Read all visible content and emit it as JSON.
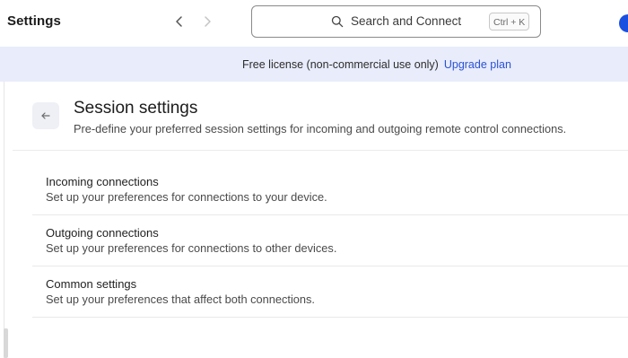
{
  "app": {
    "title": "Settings"
  },
  "search": {
    "text": "Search and Connect",
    "shortcut": "Ctrl + K"
  },
  "license": {
    "text": "Free license (non-commercial use only)",
    "upgrade_label": "Upgrade plan"
  },
  "page": {
    "title": "Session settings",
    "subtitle": "Pre-define your preferred session settings for incoming and outgoing remote control connections."
  },
  "items": [
    {
      "title": "Incoming connections",
      "description": "Set up your preferences for connections to your device."
    },
    {
      "title": "Outgoing connections",
      "description": "Set up your preferences for connections to other devices."
    },
    {
      "title": "Common settings",
      "description": "Set up your preferences that affect both connections."
    }
  ],
  "colors": {
    "accent": "#2b52d4",
    "license_bg": "#e8ecfb",
    "avatar": "#1b4fe0"
  },
  "icons": {
    "back_nav": "chevron-left-icon",
    "forward_nav": "chevron-right-icon",
    "search": "search-icon",
    "page_back": "arrow-left-icon"
  }
}
